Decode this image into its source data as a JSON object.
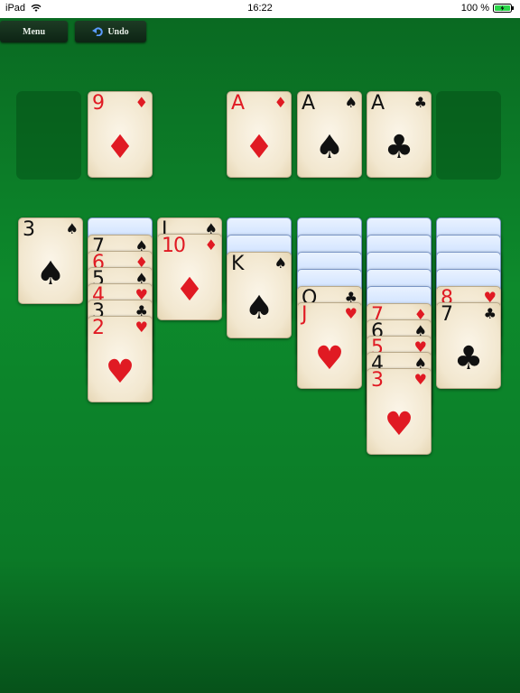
{
  "status": {
    "device": "iPad",
    "time": "16:22",
    "battery": "100 %"
  },
  "toolbar": {
    "menu_label": "Menu",
    "undo_label": "Undo"
  },
  "colors": {
    "red": "#e01a23",
    "black": "#111111",
    "felt": "#0d8a2c"
  },
  "stock": {
    "empty": true
  },
  "waste": [
    {
      "rank": "9",
      "suit": "♦",
      "color": "red"
    }
  ],
  "foundations": [
    {
      "rank": "A",
      "suit": "♦",
      "color": "red"
    },
    {
      "rank": "A",
      "suit": "♠",
      "color": "black"
    },
    {
      "rank": "A",
      "suit": "♣",
      "color": "black"
    },
    null
  ],
  "tableau": [
    {
      "down": 0,
      "up": [
        {
          "rank": "3",
          "suit": "♠",
          "color": "black"
        }
      ]
    },
    {
      "down": 1,
      "up": [
        {
          "rank": "7",
          "suit": "♠",
          "color": "black"
        },
        {
          "rank": "6",
          "suit": "♦",
          "color": "red"
        },
        {
          "rank": "5",
          "suit": "♠",
          "color": "black"
        },
        {
          "rank": "4",
          "suit": "♥",
          "color": "red"
        },
        {
          "rank": "3",
          "suit": "♣",
          "color": "black"
        },
        {
          "rank": "2",
          "suit": "♥",
          "color": "red"
        }
      ]
    },
    {
      "down": 0,
      "up": [
        {
          "rank": "J",
          "suit": "♠",
          "color": "black"
        },
        {
          "rank": "10",
          "suit": "♦",
          "color": "red"
        }
      ]
    },
    {
      "down": 2,
      "up": [
        {
          "rank": "K",
          "suit": "♠",
          "color": "black"
        }
      ]
    },
    {
      "down": 4,
      "up": [
        {
          "rank": "Q",
          "suit": "♣",
          "color": "black"
        },
        {
          "rank": "J",
          "suit": "♥",
          "color": "red"
        }
      ]
    },
    {
      "down": 5,
      "up": [
        {
          "rank": "7",
          "suit": "♦",
          "color": "red"
        },
        {
          "rank": "6",
          "suit": "♠",
          "color": "black"
        },
        {
          "rank": "5",
          "suit": "♥",
          "color": "red"
        },
        {
          "rank": "4",
          "suit": "♠",
          "color": "black"
        },
        {
          "rank": "3",
          "suit": "♥",
          "color": "red"
        }
      ]
    },
    {
      "down": 4,
      "up": [
        {
          "rank": "8",
          "suit": "♥",
          "color": "red"
        },
        {
          "rank": "7",
          "suit": "♣",
          "color": "black"
        }
      ]
    }
  ]
}
